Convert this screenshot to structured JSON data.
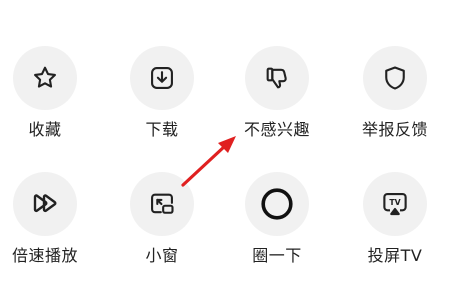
{
  "share_panel": {
    "actions": [
      {
        "label": "收藏",
        "icon": "star-icon"
      },
      {
        "label": "下载",
        "icon": "download-icon"
      },
      {
        "label": "不感兴趣",
        "icon": "thumbs-down-icon"
      },
      {
        "label": "举报反馈",
        "icon": "shield-icon"
      },
      {
        "label": "倍速播放",
        "icon": "fast-forward-icon"
      },
      {
        "label": "小窗",
        "icon": "picture-in-picture-icon"
      },
      {
        "label": "圈一下",
        "icon": "circle-icon"
      },
      {
        "label": "投屏TV",
        "icon": "tv-cast-icon"
      }
    ]
  },
  "colors": {
    "icon": "#222222",
    "circle_bg": "#f1f1f1",
    "annotation_arrow": "#e02020"
  }
}
